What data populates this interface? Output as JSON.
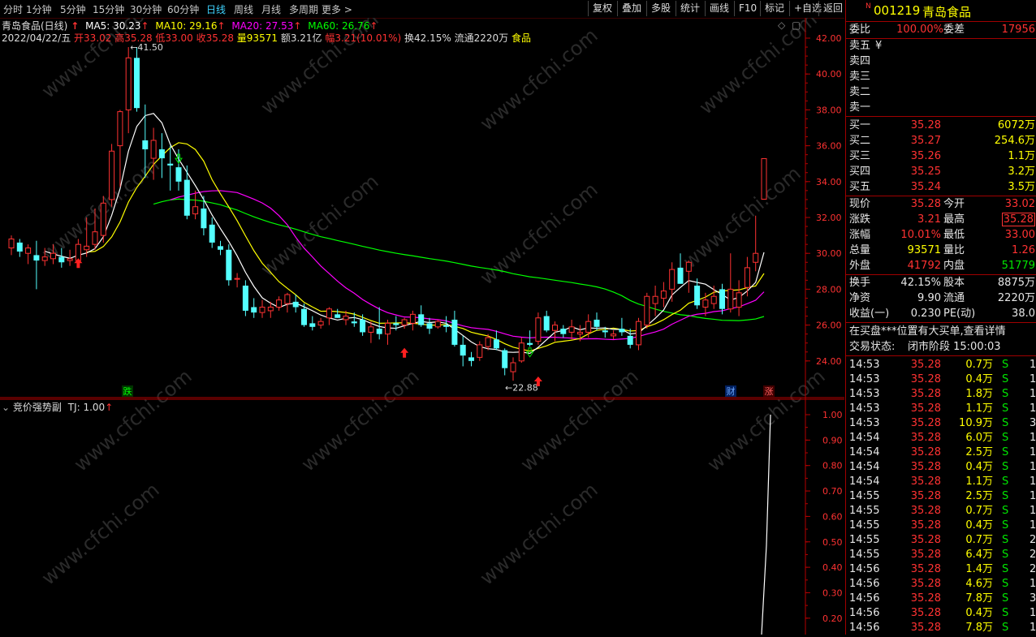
{
  "toolbar": {
    "periods": [
      "分时",
      "1分钟",
      "5分钟",
      "15分钟",
      "30分钟",
      "60分钟",
      "日线",
      "周线",
      "月线",
      "多周期",
      "更多"
    ],
    "active_period": "日线",
    "more_arrow": ">",
    "buttons": [
      "复权",
      "叠加",
      "多股",
      "统计",
      "画线",
      "F10",
      "标记",
      "+自选",
      "返回"
    ]
  },
  "main_chart": {
    "stock_title": "青岛食品(日线)",
    "ma": [
      {
        "label": "MA5: 30.23",
        "color": "#ffffff"
      },
      {
        "label": "MA10: 29.16",
        "color": "#ffff00"
      },
      {
        "label": "MA20: 27.53",
        "color": "#ff00ff"
      },
      {
        "label": "MA60: 26.76",
        "color": "#00ff00"
      }
    ],
    "info_date": "2022/04/22/五",
    "info_open": "开33.02",
    "info_high": "高35.28",
    "info_low": "低33.00",
    "info_close": "收35.28",
    "info_vol": "量93571",
    "info_amt": "额3.21亿",
    "info_chg": "幅3.21(10.01%)",
    "info_turn": "换42.15%",
    "info_float": "流通2220万",
    "info_sector": "食品",
    "y_labels": [
      "42.00",
      "40.00",
      "38.00",
      "36.00",
      "34.00",
      "32.00",
      "30.00",
      "28.00",
      "26.00",
      "24.00"
    ],
    "high_annotation": "41.50",
    "low_annotation": "22.88",
    "marker_die": "跌",
    "marker_cai": "财",
    "marker_zhang": "涨",
    "watermark": "www.cfchi.com"
  },
  "sub_chart": {
    "title": "竞价强势副",
    "tj_label": "TJ: 1.00",
    "y_labels": [
      "1.00",
      "0.90",
      "0.80",
      "0.70",
      "0.60",
      "0.50",
      "0.40",
      "0.30",
      "0.20"
    ]
  },
  "quote": {
    "flag": "N",
    "code": "001219",
    "name": "青岛食品",
    "weibi_label": "委比",
    "weibi_val": "100.00%",
    "weicha_label": "委差",
    "weicha_val": "17956",
    "sell": [
      {
        "label": "卖五",
        "price": "¥",
        "vol": ""
      },
      {
        "label": "卖四",
        "price": "",
        "vol": ""
      },
      {
        "label": "卖三",
        "price": "",
        "vol": ""
      },
      {
        "label": "卖二",
        "price": "",
        "vol": ""
      },
      {
        "label": "卖一",
        "price": "",
        "vol": ""
      }
    ],
    "buy": [
      {
        "label": "买一",
        "price": "35.28",
        "vol": "6072万"
      },
      {
        "label": "买二",
        "price": "35.27",
        "vol": "254.6万"
      },
      {
        "label": "买三",
        "price": "35.26",
        "vol": "1.1万"
      },
      {
        "label": "买四",
        "price": "35.25",
        "vol": "3.2万"
      },
      {
        "label": "买五",
        "price": "35.24",
        "vol": "3.5万"
      }
    ],
    "stats1": [
      {
        "l1": "现价",
        "v1": "35.28",
        "c1": "red",
        "l2": "今开",
        "v2": "33.02",
        "c2": "red",
        "box2": false
      },
      {
        "l1": "涨跌",
        "v1": "3.21",
        "c1": "red",
        "l2": "最高",
        "v2": "35.28",
        "c2": "red",
        "box2": true
      },
      {
        "l1": "涨幅",
        "v1": "10.01%",
        "c1": "red",
        "l2": "最低",
        "v2": "33.00",
        "c2": "red",
        "box2": false
      },
      {
        "l1": "总量",
        "v1": "93571",
        "c1": "yel",
        "l2": "量比",
        "v2": "1.26",
        "c2": "red",
        "box2": false
      },
      {
        "l1": "外盘",
        "v1": "41792",
        "c1": "red",
        "l2": "内盘",
        "v2": "51779",
        "c2": "grn",
        "box2": false
      }
    ],
    "stats2": [
      {
        "l1": "换手",
        "v1": "42.15%",
        "l2": "股本",
        "v2": "8875万"
      },
      {
        "l1": "净资",
        "v1": "9.90",
        "l2": "流通",
        "v2": "2220万"
      },
      {
        "l1": "收益(一)",
        "v1": "0.230",
        "l2": "PE(动)",
        "v2": "38.0"
      }
    ],
    "notice": "在买盘***位置有大买单,查看详情",
    "trade_status_label": "交易状态:",
    "trade_status_value": "闭市阶段 15:00:03",
    "ticks": [
      {
        "time": "14:53",
        "price": "35.28",
        "vol": "0.7万",
        "side": "S",
        "n": "1"
      },
      {
        "time": "14:53",
        "price": "35.28",
        "vol": "0.4万",
        "side": "S",
        "n": "1"
      },
      {
        "time": "14:53",
        "price": "35.28",
        "vol": "1.8万",
        "side": "S",
        "n": "1"
      },
      {
        "time": "14:53",
        "price": "35.28",
        "vol": "1.1万",
        "side": "S",
        "n": "1"
      },
      {
        "time": "14:53",
        "price": "35.28",
        "vol": "10.9万",
        "side": "S",
        "n": "3"
      },
      {
        "time": "14:54",
        "price": "35.28",
        "vol": "6.0万",
        "side": "S",
        "n": "1"
      },
      {
        "time": "14:54",
        "price": "35.28",
        "vol": "2.5万",
        "side": "S",
        "n": "1"
      },
      {
        "time": "14:54",
        "price": "35.28",
        "vol": "0.4万",
        "side": "S",
        "n": "1"
      },
      {
        "time": "14:54",
        "price": "35.28",
        "vol": "1.1万",
        "side": "S",
        "n": "1"
      },
      {
        "time": "14:55",
        "price": "35.28",
        "vol": "2.5万",
        "side": "S",
        "n": "1"
      },
      {
        "time": "14:55",
        "price": "35.28",
        "vol": "0.7万",
        "side": "S",
        "n": "1"
      },
      {
        "time": "14:55",
        "price": "35.28",
        "vol": "0.4万",
        "side": "S",
        "n": "1"
      },
      {
        "time": "14:55",
        "price": "35.28",
        "vol": "0.7万",
        "side": "S",
        "n": "2"
      },
      {
        "time": "14:55",
        "price": "35.28",
        "vol": "6.4万",
        "side": "S",
        "n": "2"
      },
      {
        "time": "14:56",
        "price": "35.28",
        "vol": "1.4万",
        "side": "S",
        "n": "2"
      },
      {
        "time": "14:56",
        "price": "35.28",
        "vol": "4.6万",
        "side": "S",
        "n": "1"
      },
      {
        "time": "14:56",
        "price": "35.28",
        "vol": "7.8万",
        "side": "S",
        "n": "3"
      },
      {
        "time": "14:56",
        "price": "35.28",
        "vol": "0.4万",
        "side": "S",
        "n": "1"
      },
      {
        "time": "14:56",
        "price": "35.28",
        "vol": "7.8万",
        "side": "S",
        "n": "1"
      }
    ]
  },
  "colors": {
    "up": "#ff3232",
    "down": "#54ffff",
    "axis": "#b40000",
    "ma5": "#ffffff",
    "ma10": "#ffff00",
    "ma20": "#ff00ff",
    "ma60": "#00ff00"
  }
}
